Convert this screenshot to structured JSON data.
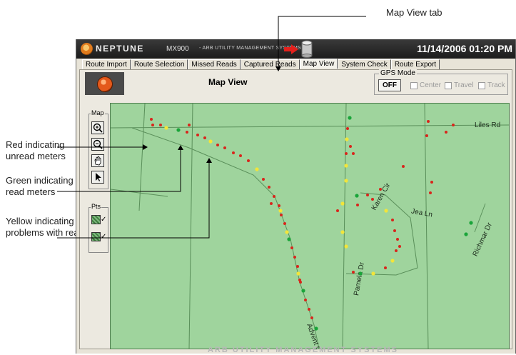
{
  "callouts": {
    "red": "Red indicating unread meters",
    "green": "Green indicating read meters",
    "yellow": "Yellow indicating problems with reads",
    "map_tab": "Map View tab"
  },
  "window": {
    "brand": "NEPTUNE",
    "model": "MX900",
    "company": "- ARB UTILITY MANAGEMENT SYSTEMS",
    "datetime": "11/14/2006 01:20 PM"
  },
  "tabs": [
    {
      "label": "Route Import"
    },
    {
      "label": "Route Selection"
    },
    {
      "label": "Missed Reads"
    },
    {
      "label": "Captured Reads"
    },
    {
      "label": "Map View",
      "active": true
    },
    {
      "label": "System Check"
    },
    {
      "label": "Route Export"
    }
  ],
  "view": {
    "title": "Map View"
  },
  "gps": {
    "legend": "GPS Mode",
    "button": "OFF",
    "options": [
      "Center",
      "Travel",
      "Track"
    ]
  },
  "tools": {
    "map_legend": "Map",
    "pts_legend": "Pts"
  },
  "streets": [
    "Liles Rd",
    "Karen Cir",
    "Jea Ln",
    "Richmar Dr",
    "Pamela Dr",
    "Advent Cir"
  ],
  "footer": "ARB UTILITY MANAGEMENT SYSTEMS",
  "colors": {
    "unread": "#d9251c",
    "read": "#1aa53a",
    "problem": "#f2e53a",
    "map_bg": "#9fd49d"
  }
}
